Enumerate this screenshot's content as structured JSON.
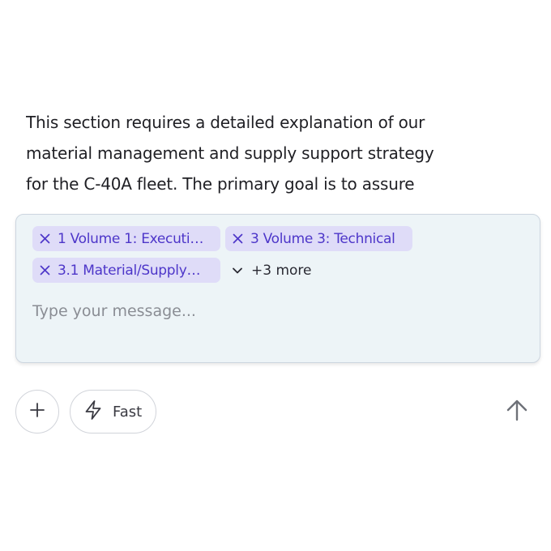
{
  "document": {
    "lines": [
      "This section requires a detailed explanation of our",
      "material management and supply support strategy",
      "for the C-40A fleet. The primary goal is to assure"
    ]
  },
  "composer": {
    "chips": [
      {
        "label": "1 Volume 1: Executi…"
      },
      {
        "label": "3 Volume 3: Technical"
      },
      {
        "label": "3.1 Material/Supply…"
      }
    ],
    "more_label": "+3 more",
    "input_value": "",
    "input_placeholder": "Type your message..."
  },
  "toolbar": {
    "mode_label": "Fast"
  },
  "colors": {
    "chip_bg": "#dfdcf8",
    "chip_text": "#4d36c9",
    "composer_bg": "#edf4f7"
  },
  "icons": {
    "chip_remove": "close-icon",
    "more": "chevron-down-icon",
    "add": "plus-icon",
    "mode": "lightning-icon",
    "send": "arrow-up-icon"
  }
}
